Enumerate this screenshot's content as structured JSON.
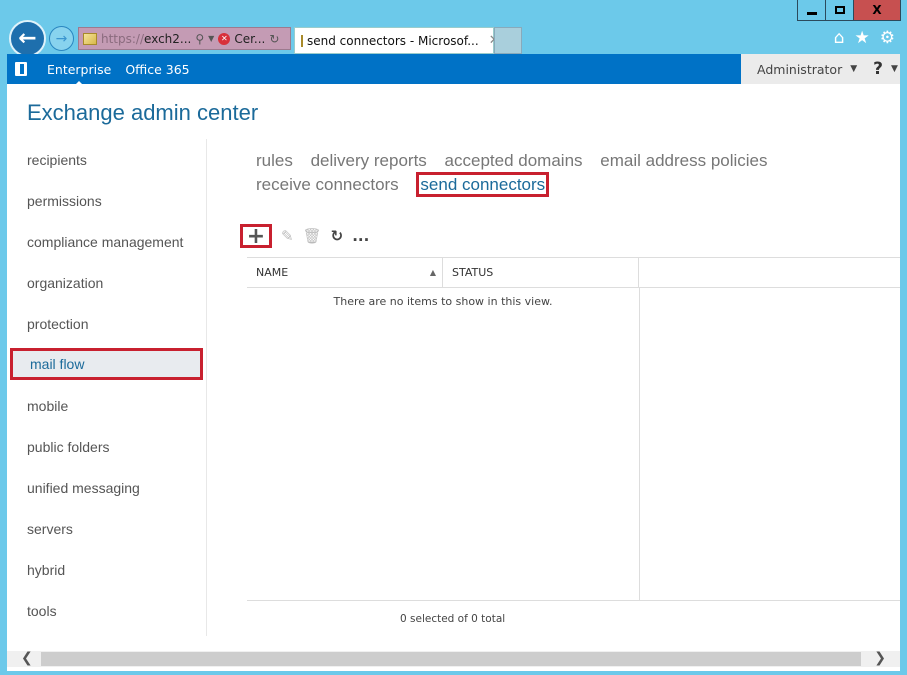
{
  "browser": {
    "address": {
      "scheme": "https://",
      "host": "exch2...",
      "cert_label": "Cer..."
    },
    "tab_title": "send connectors - Microsof...",
    "window_controls": {
      "minimize": "minimize",
      "maximize": "maximize",
      "close": "X"
    }
  },
  "topbar": {
    "nav": [
      "Enterprise",
      "Office 365"
    ],
    "user": "Administrator",
    "help": "?"
  },
  "page_title": "Exchange admin center",
  "sidebar": {
    "items": [
      {
        "label": "recipients"
      },
      {
        "label": "permissions"
      },
      {
        "label": "compliance management"
      },
      {
        "label": "organization"
      },
      {
        "label": "protection"
      },
      {
        "label": "mail flow",
        "selected": true
      },
      {
        "label": "mobile"
      },
      {
        "label": "public folders"
      },
      {
        "label": "unified messaging"
      },
      {
        "label": "servers"
      },
      {
        "label": "hybrid"
      },
      {
        "label": "tools"
      }
    ]
  },
  "subnav": {
    "items": [
      "rules",
      "delivery reports",
      "accepted domains",
      "email address policies",
      "receive connectors",
      "send connectors"
    ],
    "selected": "send connectors"
  },
  "toolbar": {
    "add": "+",
    "edit": "edit",
    "delete": "delete",
    "refresh": "refresh",
    "more": "..."
  },
  "grid": {
    "columns": [
      "NAME",
      "STATUS"
    ],
    "sort_indicator": "▲",
    "empty_message": "There are no items to show in this view.",
    "rows": []
  },
  "status": "0 selected of 0 total"
}
